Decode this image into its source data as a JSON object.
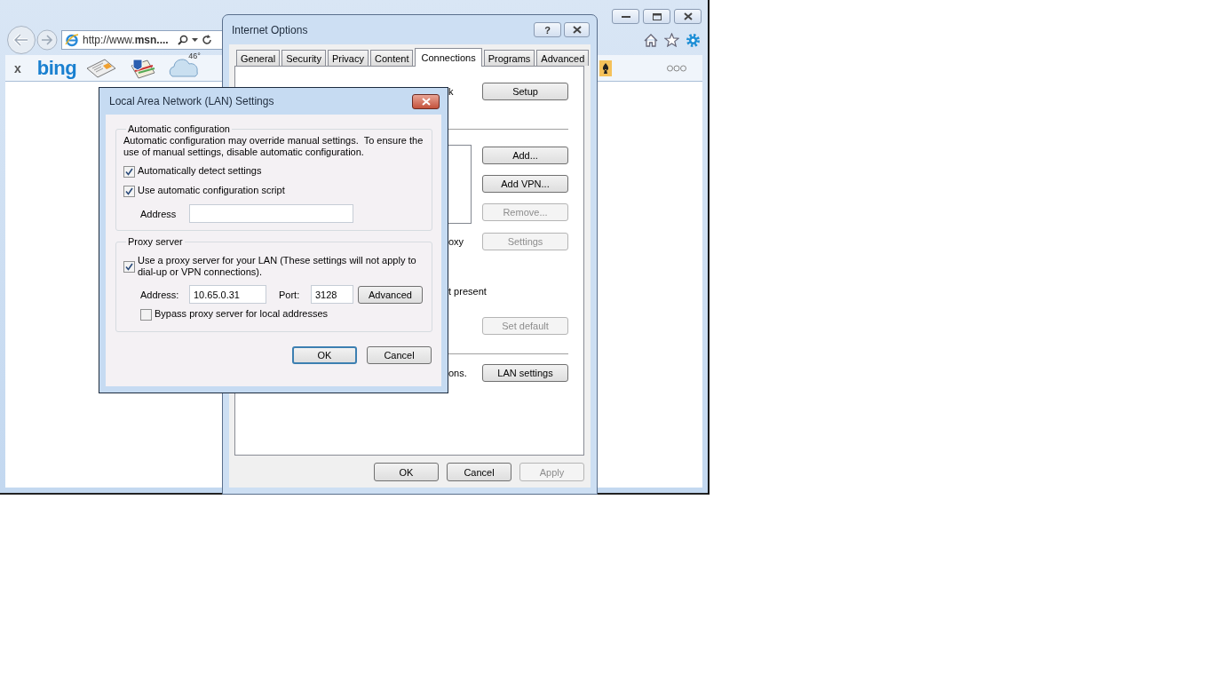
{
  "browser": {
    "address": "http://www.**msn....**",
    "favorites_close": "x",
    "logo": "bing",
    "temperature": "46°"
  },
  "internet_options": {
    "title": "Internet Options",
    "help": "?",
    "tabs": [
      {
        "label": "General",
        "selected": false
      },
      {
        "label": "Security",
        "selected": false
      },
      {
        "label": "Privacy",
        "selected": false
      },
      {
        "label": "Content",
        "selected": false
      },
      {
        "label": "Connections",
        "selected": true
      },
      {
        "label": "Programs",
        "selected": false
      },
      {
        "label": "Advanced",
        "selected": false
      }
    ],
    "setup_row": {
      "fragment": "k",
      "button": {
        "label": "Setup",
        "disabled": false
      }
    },
    "connection_buttons": [
      {
        "label": "Add...",
        "disabled": false
      },
      {
        "label": "Add VPN...",
        "disabled": false
      },
      {
        "label": "Remove...",
        "disabled": true
      }
    ],
    "settings_row": {
      "fragment": "oxy",
      "button": {
        "label": "Settings",
        "disabled": true
      }
    },
    "status_fragment": "t present",
    "default_button": {
      "label": "Set default",
      "disabled": true
    },
    "lan_row": {
      "fragment": "ons.",
      "button": {
        "label": "LAN settings",
        "disabled": false
      }
    },
    "buttons": [
      {
        "label": "OK",
        "disabled": false
      },
      {
        "label": "Cancel",
        "disabled": false
      },
      {
        "label": "Apply",
        "disabled": true
      }
    ]
  },
  "lan_dialog": {
    "title": "Local Area Network (LAN) Settings",
    "auto_group": {
      "legend": "Automatic configuration",
      "note": "Automatic configuration may override manual settings.  To ensure the use of manual settings, disable automatic configuration.",
      "options": [
        {
          "label": "Automatically detect settings",
          "checked": true
        },
        {
          "label": "Use automatic configuration script",
          "checked": true
        }
      ],
      "address_label": "Address"
    },
    "proxy_group": {
      "legend": "Proxy server",
      "use_proxy": {
        "label": "Use a proxy server for your LAN (These settings will not apply to dial-up or VPN connections).",
        "checked": true
      },
      "address_label": "Address:",
      "address": "10.65.0.31",
      "port_label": "Port:",
      "port": "3128",
      "advanced": "Advanced",
      "bypass": {
        "label": "Bypass proxy server for local addresses",
        "checked": false
      }
    },
    "buttons": [
      {
        "label": "OK",
        "default": true
      },
      {
        "label": "Cancel",
        "default": false
      }
    ]
  }
}
